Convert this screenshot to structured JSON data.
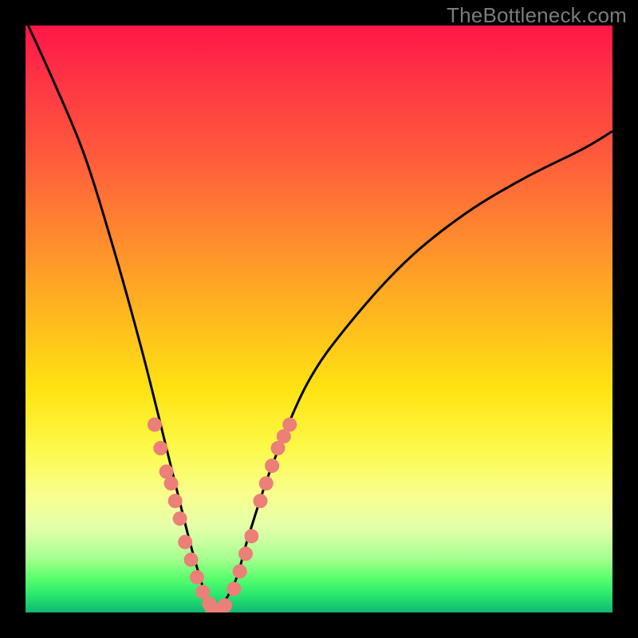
{
  "attribution": "TheBottleneck.com",
  "chart_data": {
    "type": "line",
    "title": "",
    "xlabel": "",
    "ylabel": "",
    "xlim": [
      0,
      100
    ],
    "ylim": [
      0,
      100
    ],
    "grid": false,
    "series": [
      {
        "name": "bottleneck-curve",
        "x": [
          0,
          5,
          10,
          15,
          20,
          25,
          28,
          30,
          31,
          32.5,
          34,
          36,
          38,
          42,
          48,
          55,
          65,
          75,
          85,
          95,
          100
        ],
        "values": [
          101,
          90,
          78,
          62,
          44,
          24,
          12,
          5,
          2,
          0,
          2,
          6,
          13,
          25,
          39,
          49,
          60,
          68,
          74,
          79,
          82
        ]
      }
    ],
    "markers": [
      {
        "name": "left-cluster",
        "color": "#ec7f78",
        "points": [
          {
            "x": 22,
            "y": 32
          },
          {
            "x": 23,
            "y": 28
          },
          {
            "x": 24,
            "y": 24
          },
          {
            "x": 24.8,
            "y": 22
          },
          {
            "x": 25.5,
            "y": 19
          },
          {
            "x": 26.3,
            "y": 16
          },
          {
            "x": 27.2,
            "y": 12
          },
          {
            "x": 28.2,
            "y": 9
          },
          {
            "x": 29.2,
            "y": 6
          },
          {
            "x": 30.2,
            "y": 3.5
          },
          {
            "x": 31.3,
            "y": 1.5
          }
        ]
      },
      {
        "name": "bottom-cluster",
        "color": "#ec7f78",
        "points": [
          {
            "x": 31.8,
            "y": 0.5
          },
          {
            "x": 32.5,
            "y": 0.2
          },
          {
            "x": 33.2,
            "y": 0.5
          },
          {
            "x": 34.0,
            "y": 1.2
          }
        ]
      },
      {
        "name": "right-cluster",
        "color": "#ec7f78",
        "points": [
          {
            "x": 35.5,
            "y": 4
          },
          {
            "x": 36.5,
            "y": 7
          },
          {
            "x": 37.5,
            "y": 10
          },
          {
            "x": 38.5,
            "y": 13
          },
          {
            "x": 40.0,
            "y": 19
          },
          {
            "x": 41.0,
            "y": 22
          },
          {
            "x": 42.0,
            "y": 25
          },
          {
            "x": 43.0,
            "y": 28
          },
          {
            "x": 44.0,
            "y": 30
          },
          {
            "x": 45.0,
            "y": 32
          }
        ]
      }
    ]
  }
}
